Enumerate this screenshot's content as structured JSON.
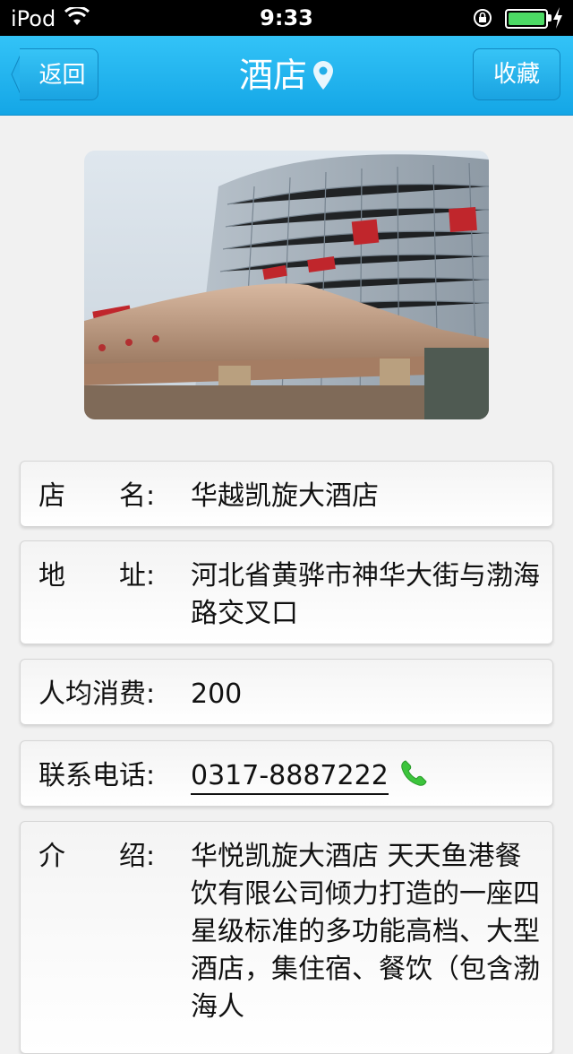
{
  "status_bar": {
    "carrier": "iPod",
    "time": "9:33"
  },
  "nav": {
    "back_label": "返回",
    "title": "酒店",
    "fav_label": "收藏"
  },
  "details": {
    "name_label": "店  名:",
    "name_value": "华越凯旋大酒店",
    "address_label": "地  址:",
    "address_value": "河北省黄骅市神华大街与渤海路交叉口",
    "avg_label": "人均消费:",
    "avg_value": "200",
    "phone_label": "联系电话:",
    "phone_value": "0317-8887222",
    "intro_label": "介  绍:",
    "intro_value": "华悦凯旋大酒店 天天鱼港餐饮有限公司倾力打造的一座四星级标准的多功能高档、大型酒店，集住宿、餐饮（包含渤海人"
  },
  "colors": {
    "nav_bar": "#1eb0ec",
    "phone_icon": "#3cc43c"
  },
  "icons": {
    "location": "location-pin-icon",
    "phone": "phone-icon",
    "wifi": "wifi-icon",
    "battery": "battery-icon"
  }
}
